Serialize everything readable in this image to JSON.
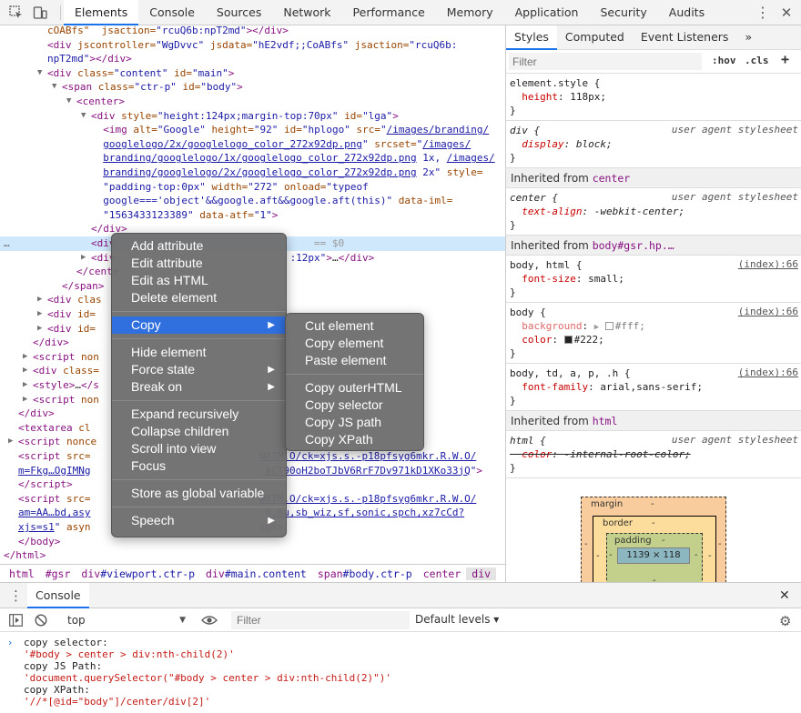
{
  "toolbar": {
    "tabs": [
      "Elements",
      "Console",
      "Sources",
      "Network",
      "Performance",
      "Memory",
      "Application",
      "Security",
      "Audits"
    ],
    "active_tab": "Elements"
  },
  "dom_lines": [
    {
      "indent": 52,
      "tri": "",
      "html": "<span class='attr'>cOABfs\"</span><span class='attr'>  jsaction=</span><span class='val'>\"rcuQ6b:npT2md\"</span><span class='tag'>&gt;&lt;/div&gt;</span>"
    },
    {
      "indent": 52,
      "tri": "",
      "html": "<span class='tag'>&lt;div</span> <span class='attr'>jscontroller=</span><span class='val'>\"WgDvvc\"</span> <span class='attr'>jsdata=</span><span class='val'>\"hE2vdf;;CoABfs\"</span> <span class='attr'>jsaction=</span><span class='val'>\"rcuQ6b:</span>"
    },
    {
      "indent": 52,
      "tri": "",
      "html": "<span class='val'>npT2md\"</span><span class='tag'>&gt;&lt;/div&gt;</span>"
    },
    {
      "indent": 52,
      "tri": "▼",
      "html": "<span class='tag'>&lt;div</span> <span class='attr'>class=</span><span class='val'>\"content\"</span> <span class='attr'>id=</span><span class='val'>\"main\"</span><span class='tag'>&gt;</span>"
    },
    {
      "indent": 68,
      "tri": "▼",
      "html": "<span class='tag'>&lt;span</span> <span class='attr'>class=</span><span class='val'>\"ctr-p\"</span> <span class='attr'>id=</span><span class='val'>\"body\"</span><span class='tag'>&gt;</span>"
    },
    {
      "indent": 84,
      "tri": "▼",
      "html": "<span class='tag'>&lt;center&gt;</span>"
    },
    {
      "indent": 100,
      "tri": "▼",
      "html": "<span class='tag'>&lt;div</span> <span class='attr'>style=</span><span class='val'>\"height:124px;margin-top:70px\"</span> <span class='attr'>id=</span><span class='val'>\"lga\"</span><span class='tag'>&gt;</span>"
    },
    {
      "indent": 100,
      "tri": "",
      "html": "  <span class='tag'>&lt;img</span> <span class='attr'>alt=</span><span class='val'>\"Google\"</span> <span class='attr'>height=</span><span class='val'>\"92\"</span> <span class='attr'>id=</span><span class='val'>\"hplogo\"</span> <span class='attr'>src=</span><span class='val'>\"</span><span class='lnk'>/images/branding/</span>"
    },
    {
      "indent": 100,
      "tri": "",
      "html": "  <span class='lnk'>googlelogo/2x/googlelogo_color_272x92dp.png</span><span class='val'>\"</span> <span class='attr'>srcset=</span><span class='val'>\"</span><span class='lnk'>/images/</span>"
    },
    {
      "indent": 100,
      "tri": "",
      "html": "  <span class='lnk'>branding/googlelogo/1x/googlelogo_color_272x92dp.png</span><span class='val'> 1x, </span><span class='lnk'>/images/</span>"
    },
    {
      "indent": 100,
      "tri": "",
      "html": "  <span class='lnk'>branding/googlelogo/2x/googlelogo_color_272x92dp.png</span><span class='val'> 2x\"</span> <span class='attr'>style=</span>"
    },
    {
      "indent": 100,
      "tri": "",
      "html": "  <span class='val'>\"padding-top:0px\"</span> <span class='attr'>width=</span><span class='val'>\"272\"</span> <span class='attr'>onload=</span><span class='val'>\"typeof</span>"
    },
    {
      "indent": 100,
      "tri": "",
      "html": "  <span class='val'>google==='object'&amp;&amp;google.aft&amp;&amp;google.aft(this)\"</span> <span class='attr'>data-iml=</span>"
    },
    {
      "indent": 100,
      "tri": "",
      "html": "  <span class='val'>\"1563433123389\"</span> <span class='attr'>data-atf=</span><span class='val'>\"1\"</span><span class='tag'>&gt;</span>"
    },
    {
      "indent": 100,
      "tri": "",
      "html": "<span class='tag'>&lt;/div&gt;</span>"
    },
    {
      "indent": 100,
      "tri": "",
      "html": "<span class='tag'>&lt;div</span>                                 <span style='color:#999'>== $0</span>",
      "selected": true
    },
    {
      "indent": 100,
      "tri": "▶",
      "html": "<span class='tag'>&lt;div</span>                             <span class='val'>:12px\"</span><span class='tag'>&gt;</span>…<span class='tag'>&lt;/div&gt;</span>"
    },
    {
      "indent": 84,
      "tri": "",
      "html": "<span class='tag'>&lt;/cente</span>"
    },
    {
      "indent": 68,
      "tri": "",
      "html": "<span class='tag'>&lt;/span&gt;</span>"
    },
    {
      "indent": 52,
      "tri": "▶",
      "html": "<span class='tag'>&lt;div</span> <span class='attr'>clas</span>"
    },
    {
      "indent": 52,
      "tri": "▶",
      "html": "<span class='tag'>&lt;div</span> <span class='attr'>id=</span>"
    },
    {
      "indent": 52,
      "tri": "▶",
      "html": "<span class='tag'>&lt;div</span> <span class='attr'>id=</span>"
    },
    {
      "indent": 36,
      "tri": "",
      "html": "<span class='tag'>&lt;/div&gt;</span>"
    },
    {
      "indent": 36,
      "tri": "▶",
      "html": "<span class='tag'>&lt;script</span> <span class='attr'>non</span>"
    },
    {
      "indent": 36,
      "tri": "▶",
      "html": "<span class='tag'>&lt;div</span> <span class='attr'>class=</span>"
    },
    {
      "indent": 36,
      "tri": "▶",
      "html": "<span class='tag'>&lt;style&gt;</span>…<span class='tag'>&lt;/s</span>"
    },
    {
      "indent": 36,
      "tri": "▶",
      "html": "<span class='tag'>&lt;script</span> <span class='attr'>non</span>"
    },
    {
      "indent": 20,
      "tri": "",
      "html": "<span class='tag'>&lt;/div&gt;</span>"
    },
    {
      "indent": 20,
      "tri": "",
      "html": "<span class='tag'>&lt;textarea</span> <span class='attr'>cl</span>"
    },
    {
      "indent": 20,
      "tri": "▶",
      "html": "<span class='tag'>&lt;script</span> <span class='attr'>nonce</span>"
    },
    {
      "indent": 20,
      "tri": "",
      "html": "<span class='tag'>&lt;script</span> <span class='attr'>src=</span>                            <span class='lnk'>WATM.O/ck=xjs.s.-p18pfsyg6mkr.R.W.O/</span>"
    },
    {
      "indent": 20,
      "tri": "",
      "html": "<span class='lnk'>m=Fkg…OgIMNg</span>                             <span class='lnk'>ACT90oH2boTJbV6RrF7Dv971kD1XKo33jQ</span><span class='val'>\"</span><span class='tag'>&gt;</span>"
    },
    {
      "indent": 20,
      "tri": "",
      "html": "<span class='tag'>&lt;/script&gt;</span>"
    },
    {
      "indent": 20,
      "tri": "",
      "html": "<span class='tag'>&lt;script</span> <span class='attr'>src=</span>                            <span class='lnk'>WATM.O/ck=xjs.s.-p18pfsyg6mkr.R.W.O/</span>"
    },
    {
      "indent": 20,
      "tri": "",
      "html": "<span class='lnk'>am=AA…bd,asy</span>                             <span class='lnk'>d,mu,sb_wiz,sf,sonic,spch,xz7cCd?</span>"
    },
    {
      "indent": 20,
      "tri": "",
      "html": "<span class='lnk'>xjs=s1</span><span class='val'>\"</span> <span class='attr'>asyn</span>                            <span class='tag'>ipt&gt;</span>"
    },
    {
      "indent": 20,
      "tri": "",
      "html": "<span class='tag'>&lt;/body&gt;</span>"
    },
    {
      "indent": 4,
      "tri": "",
      "html": "<span class='tag'>&lt;/html&gt;</span>"
    }
  ],
  "breadcrumb": [
    {
      "tag": "html",
      "cls": ""
    },
    {
      "tag": "#gsr",
      "cls": ""
    },
    {
      "tag": "div",
      "cls": "#viewport.ctr-p"
    },
    {
      "tag": "div",
      "cls": "#main.content"
    },
    {
      "tag": "span",
      "cls": "#body.ctr-p"
    },
    {
      "tag": "center",
      "cls": ""
    },
    {
      "tag": "div",
      "cls": ""
    }
  ],
  "styles": {
    "tabs": [
      "Styles",
      "Computed",
      "Event Listeners",
      "»"
    ],
    "filter_placeholder": "Filter",
    "hov": ":hov",
    "cls": ".cls",
    "plus": "+",
    "user_agent": "user agent stylesheet",
    "source": "(index):66",
    "inherited_label": "Inherited from",
    "inherited_center": "center",
    "inherited_body": "body#gsr.hp.…",
    "inherited_html": "html",
    "rules": {
      "element_style": {
        "selector": "element.style {",
        "prop": "height",
        "value": "118px;"
      },
      "div": {
        "selector": "div {",
        "prop": "display",
        "value": "block;"
      },
      "center": {
        "selector": "center {",
        "prop": "text-align",
        "value": "-webkit-center;"
      },
      "body_html": {
        "selector": "body, html {",
        "prop": "font-size",
        "value": "small;"
      },
      "body": {
        "selector": "body {",
        "prop1": "background",
        "value1": "#fff;",
        "prop2": "color",
        "value2": "#222;"
      },
      "body_td": {
        "selector": "body, td, a, p, .h {",
        "prop": "font-family",
        "value": "arial,sans-serif;"
      },
      "html": {
        "selector": "html {",
        "prop": "color",
        "value": "-internal-root-color;"
      },
      "close": "}"
    },
    "box_model": {
      "margin_label": "margin",
      "border_label": "border",
      "padding_label": "padding",
      "dash": "-",
      "content": "1139 × 118"
    }
  },
  "context_menu": {
    "items": [
      "Add attribute",
      "Edit attribute",
      "Edit as HTML",
      "Delete element"
    ],
    "copy": "Copy",
    "items2": [
      "Hide element",
      "Force state",
      "Break on"
    ],
    "items3": [
      "Expand recursively",
      "Collapse children",
      "Scroll into view",
      "Focus"
    ],
    "store": "Store as global variable",
    "speech": "Speech"
  },
  "copy_submenu": {
    "group1": [
      "Cut element",
      "Copy element",
      "Paste element"
    ],
    "group2": [
      "Copy outerHTML",
      "Copy selector",
      "Copy JS path",
      "Copy XPath"
    ]
  },
  "console": {
    "tab": "Console",
    "context": "top",
    "filter_placeholder": "Filter",
    "levels": "Default levels ▾",
    "lines": [
      {
        "text": "copy selector:",
        "str": false
      },
      {
        "text": "'#body > center > div:nth-child(2)'",
        "str": true
      },
      {
        "text": "copy JS Path:",
        "str": false
      },
      {
        "text": "'document.querySelector(\"#body > center > div:nth-child(2)\")'",
        "str": true
      },
      {
        "text": "copy XPath:",
        "str": false
      },
      {
        "text": "'//*[@id=\"body\"]/center/div[2]'",
        "str": true
      }
    ]
  },
  "colors": {
    "accent": "#1a73e8",
    "menu_highlight": "#2f6fde",
    "selected_row": "#cfe8fc"
  }
}
